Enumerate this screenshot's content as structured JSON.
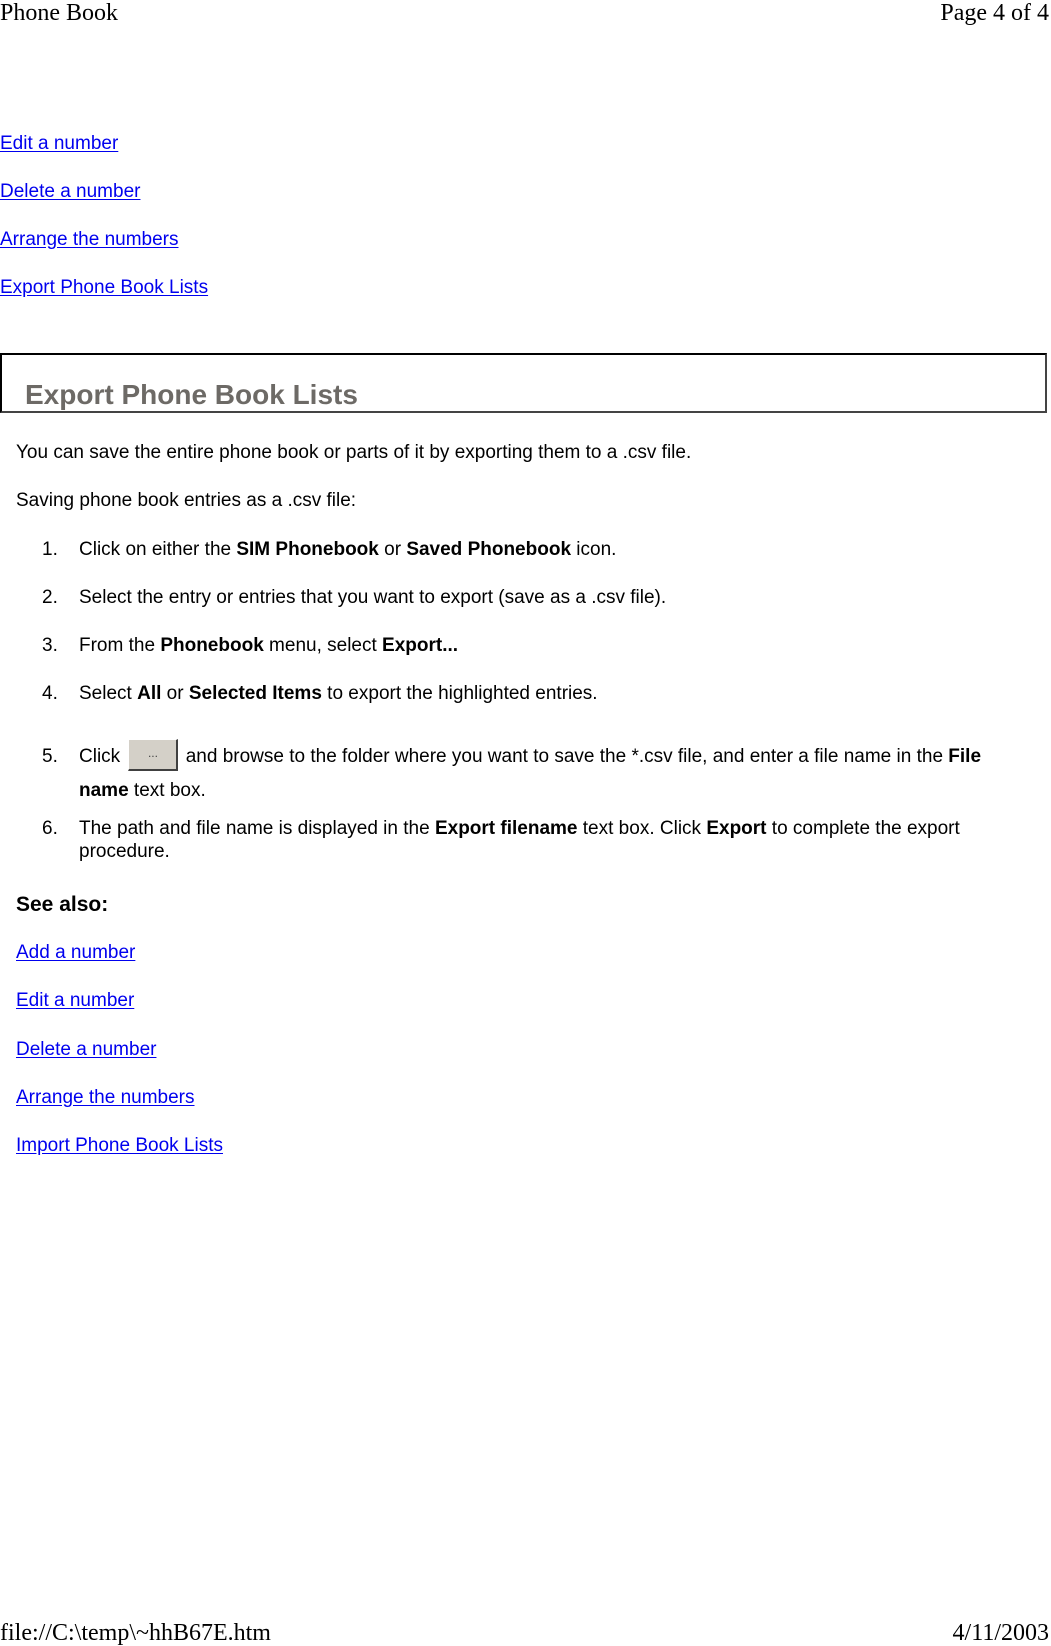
{
  "print_header": {
    "title": "Phone Book",
    "page": "Page 4 of 4"
  },
  "top_links": [
    {
      "label": "Edit a number"
    },
    {
      "label": "Delete a number"
    },
    {
      "label": "Arrange the numbers"
    },
    {
      "label": "Export Phone Book Lists"
    }
  ],
  "section": {
    "title": "Export Phone Book Lists",
    "intro": "You can save the entire phone book or parts of it by exporting them to a .csv file.",
    "subheading": "Saving phone book entries as a .csv file:",
    "steps": [
      {
        "num": "1.",
        "parts": [
          {
            "t": "Click on either the "
          },
          {
            "b": "SIM Phonebook"
          },
          {
            "t": " or "
          },
          {
            "b": "Saved Phonebook"
          },
          {
            "t": " icon."
          }
        ]
      },
      {
        "num": "2.",
        "parts": [
          {
            "t": "Select the entry or entries that you want to export (save as a .csv file)."
          }
        ]
      },
      {
        "num": "3.",
        "parts": [
          {
            "t": "From the "
          },
          {
            "b": "Phonebook"
          },
          {
            "t": " menu, select "
          },
          {
            "b": "Export..."
          }
        ]
      },
      {
        "num": "4.",
        "parts": [
          {
            "t": "Select "
          },
          {
            "b": "All"
          },
          {
            "t": " or "
          },
          {
            "b": "Selected Items"
          },
          {
            "t": " to export the highlighted entries."
          }
        ]
      },
      {
        "num": "5.",
        "parts": [
          {
            "t": "Click "
          },
          {
            "button": "..."
          },
          {
            "t": " and browse to the folder where you want to save the *.csv file, and enter a file name in the "
          },
          {
            "b": "File name"
          },
          {
            "t": " text box."
          }
        ]
      },
      {
        "num": "6.",
        "parts": [
          {
            "t": "The path and file name is displayed in the "
          },
          {
            "b": "Export filename"
          },
          {
            "t": " text box. Click "
          },
          {
            "b": "Export"
          },
          {
            "t": " to complete the export procedure."
          }
        ]
      }
    ]
  },
  "see_also": {
    "heading": "See also:",
    "links": [
      {
        "label": "Add a number"
      },
      {
        "label": "Edit a number"
      },
      {
        "label": "Delete a number"
      },
      {
        "label": "Arrange the numbers"
      },
      {
        "label": "Import Phone Book Lists"
      }
    ]
  },
  "print_footer": {
    "url": "file://C:\\temp\\~hhB67E.htm",
    "date": "4/11/2003"
  }
}
